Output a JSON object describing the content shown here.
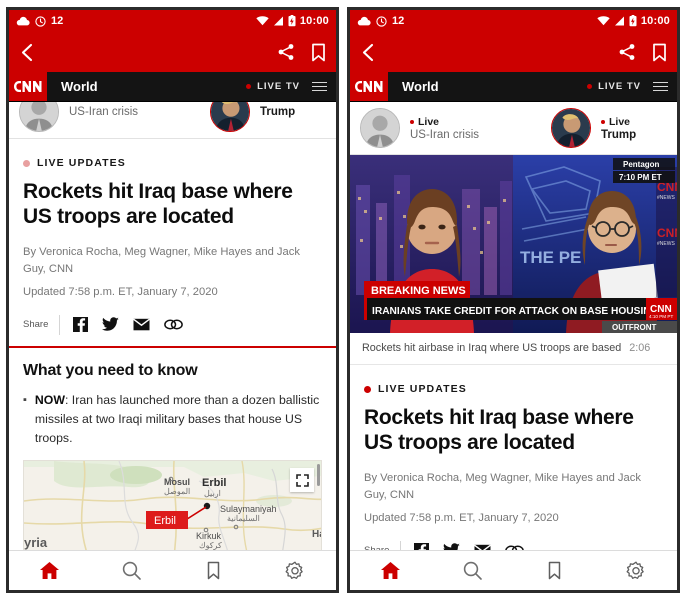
{
  "colors": {
    "brand_red": "#cc0000",
    "nav_black": "#141414",
    "text_dark": "#0d0d0d",
    "text_muted": "#777777",
    "breaking_red": "#cc0000"
  },
  "status_bar": {
    "notification_count": "12",
    "time": "10:00",
    "icons": [
      "cloud-icon",
      "alarm-icon",
      "wifi-icon",
      "signal-icon",
      "battery-charging-icon"
    ]
  },
  "action_bar": {
    "back_label": "Back",
    "share_label": "Share",
    "bookmark_label": "Bookmark"
  },
  "nav_bar": {
    "logo_text": "CNN",
    "section_title": "World",
    "live_tv_label": "LIVE TV",
    "menu_label": "Menu"
  },
  "carousel": {
    "stories": [
      {
        "live_label": "Live",
        "label": "US-Iran crisis",
        "avatar": "pence-avatar",
        "is_live": false
      },
      {
        "live_label": "Live",
        "label": "Trump",
        "avatar": "trump-avatar",
        "is_live": true
      }
    ]
  },
  "article": {
    "live_updates_label": "LIVE UPDATES",
    "headline": "Rockets hit Iraq base where US troops are located",
    "byline": "By Veronica Rocha, Meg Wagner, Mike Hayes and Jack Guy, CNN",
    "updated": "Updated 7:58 p.m. ET, January 7, 2020",
    "share_label": "Share",
    "share_icons": [
      "facebook-icon",
      "twitter-icon",
      "email-icon",
      "link-icon"
    ]
  },
  "what_you_need_to_know": {
    "title": "What you need to know",
    "bullets": [
      {
        "lead": "NOW",
        "text": ": Iran has launched more than a dozen ballistic missiles at two Iraqi military bases that house US troops."
      }
    ]
  },
  "map": {
    "labels": [
      "Mosul",
      "الموصل",
      "Erbil",
      "اربيل",
      "Sulaymaniyah",
      "السليمانية",
      "Kirkuk",
      "كركوك",
      "yria",
      "Ha"
    ],
    "marker_label": "Erbil",
    "expand_label": "Expand map"
  },
  "video": {
    "breaking_banner": "BREAKING NEWS",
    "ticker": "IRANIANS TAKE CREDIT FOR ATTACK ON BASE HOUSING U.S. TROOPS",
    "location_tag": "Pentagon",
    "time_tag": "7:10 PM ET",
    "show_tag": "OUTFRONT",
    "watermark": "CNN",
    "watermark_time": "4:10 PM PT",
    "backdrop_text": "THE PE",
    "caption": "Rockets hit airbase in Iraq where US troops are based",
    "duration": "2:06"
  },
  "bottom_nav": {
    "items": [
      {
        "name": "home",
        "label": "Home",
        "active": true
      },
      {
        "name": "search",
        "label": "Search",
        "active": false
      },
      {
        "name": "bookmarks",
        "label": "Bookmarks",
        "active": false
      },
      {
        "name": "settings",
        "label": "Settings",
        "active": false
      }
    ]
  }
}
